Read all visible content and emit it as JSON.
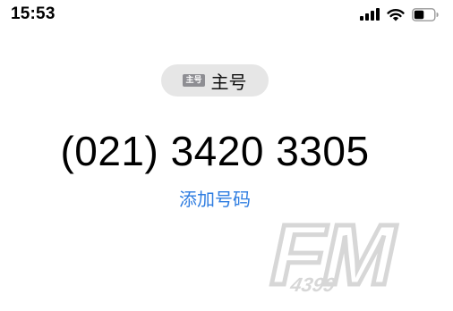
{
  "status_bar": {
    "time": "15:53",
    "icons": [
      "signal-icon",
      "wifi-icon",
      "battery-icon"
    ],
    "battery_level": 0.5
  },
  "sim_label": {
    "badge": "主号",
    "label": "主号"
  },
  "contact": {
    "phone_number": "(021) 3420 3305",
    "add_number_label": "添加号码"
  },
  "watermark": {
    "brand": "FM",
    "number": "4399"
  },
  "colors": {
    "link": "#2f7de1",
    "pill_background": "#e6e6e6",
    "badge_background": "#8e8e93"
  }
}
